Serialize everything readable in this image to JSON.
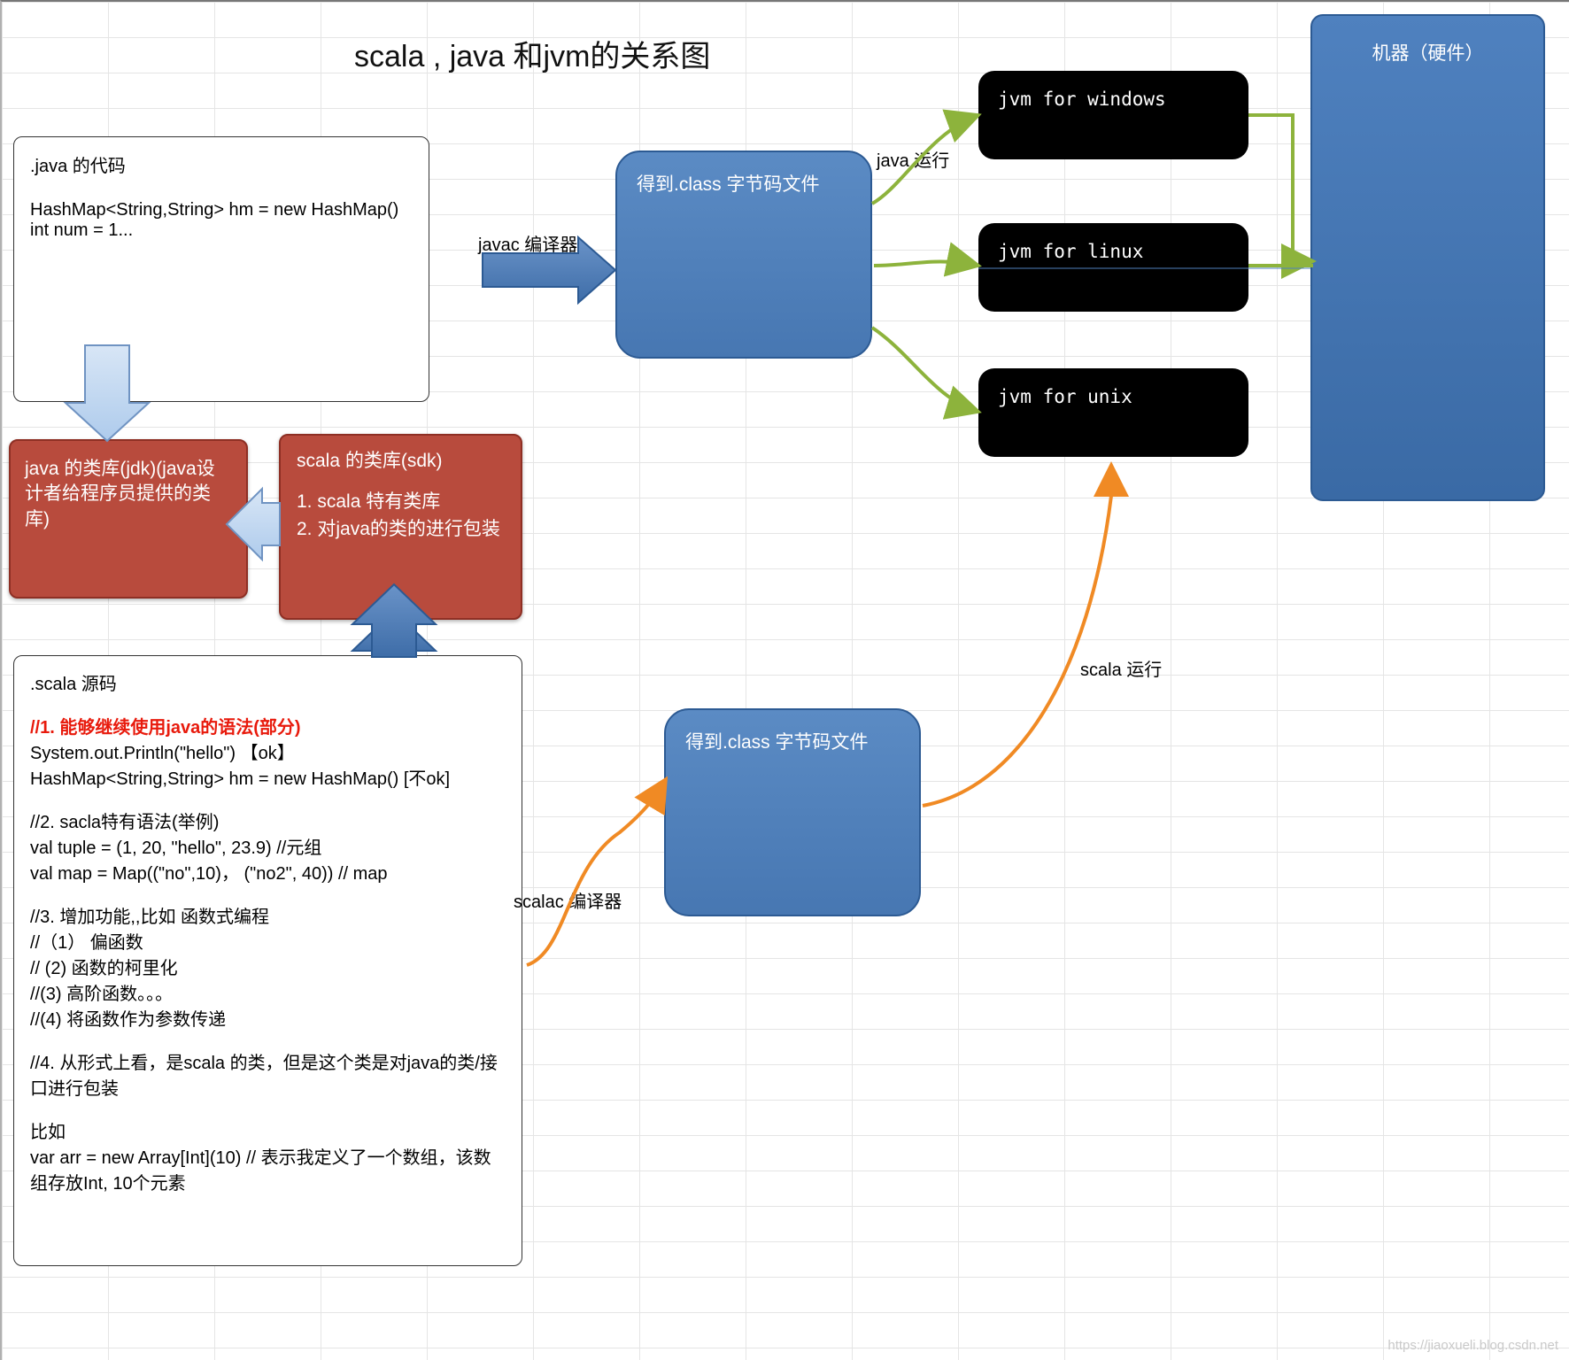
{
  "title": "scala , java 和jvm的关系图",
  "javaSrc": {
    "header": ".java 的代码",
    "line1": "HashMap<String,String> hm = new HashMap()",
    "line2": "int num = 1..."
  },
  "jdk": "java 的类库(jdk)(java设计者给程序员提供的类库)",
  "sdk": {
    "header": "scala 的类库(sdk)",
    "l1": "1.  scala 特有类库",
    "l2": "2.  对java的类的进行包装"
  },
  "scalaSrc": {
    "header": ".scala  源码",
    "s1t": "//1. 能够继续使用java的语法(部分)",
    "s1a": "System.out.Println(\"hello\") 【ok】",
    "s1b": "HashMap<String,String> hm = new HashMap() [不ok]",
    "s2t": "//2. sacla特有语法(举例)",
    "s2a": "val  tuple = (1, 20, \"hello\", 23.9) //元组",
    "s2b": "val  map = Map((\"no\",10)， (\"no2\", 40)) //  map",
    "s3t": "//3. 增加功能,,比如 函数式编程",
    "s3a": "//（1） 偏函数",
    "s3b": "// (2) 函数的柯里化",
    "s3c": "//(3) 高阶函数。。。",
    "s3d": "//(4) 将函数作为参数传递",
    "s4t": "//4. 从形式上看，是scala 的类，但是这个类是对java的类/接口进行包装",
    "s5t": "比如",
    "s5a": "var  arr  = new Array[Int](10) // 表示我定义了一个数组，该数组存放Int,  10个元素"
  },
  "class1": "得到.class 字节码文件",
  "class2": "得到.class 字节码文件",
  "jvm": {
    "win": "jvm for windows",
    "linux": "jvm for linux",
    "unix": "jvm for unix"
  },
  "machine": "机器（硬件）",
  "labels": {
    "javac": "javac 编译器",
    "scalac": "scalac 编译器",
    "javaRun": "java 运行",
    "scalaRun": "scala 运行"
  },
  "watermark": "https://jiaoxueli.blog.csdn.net"
}
